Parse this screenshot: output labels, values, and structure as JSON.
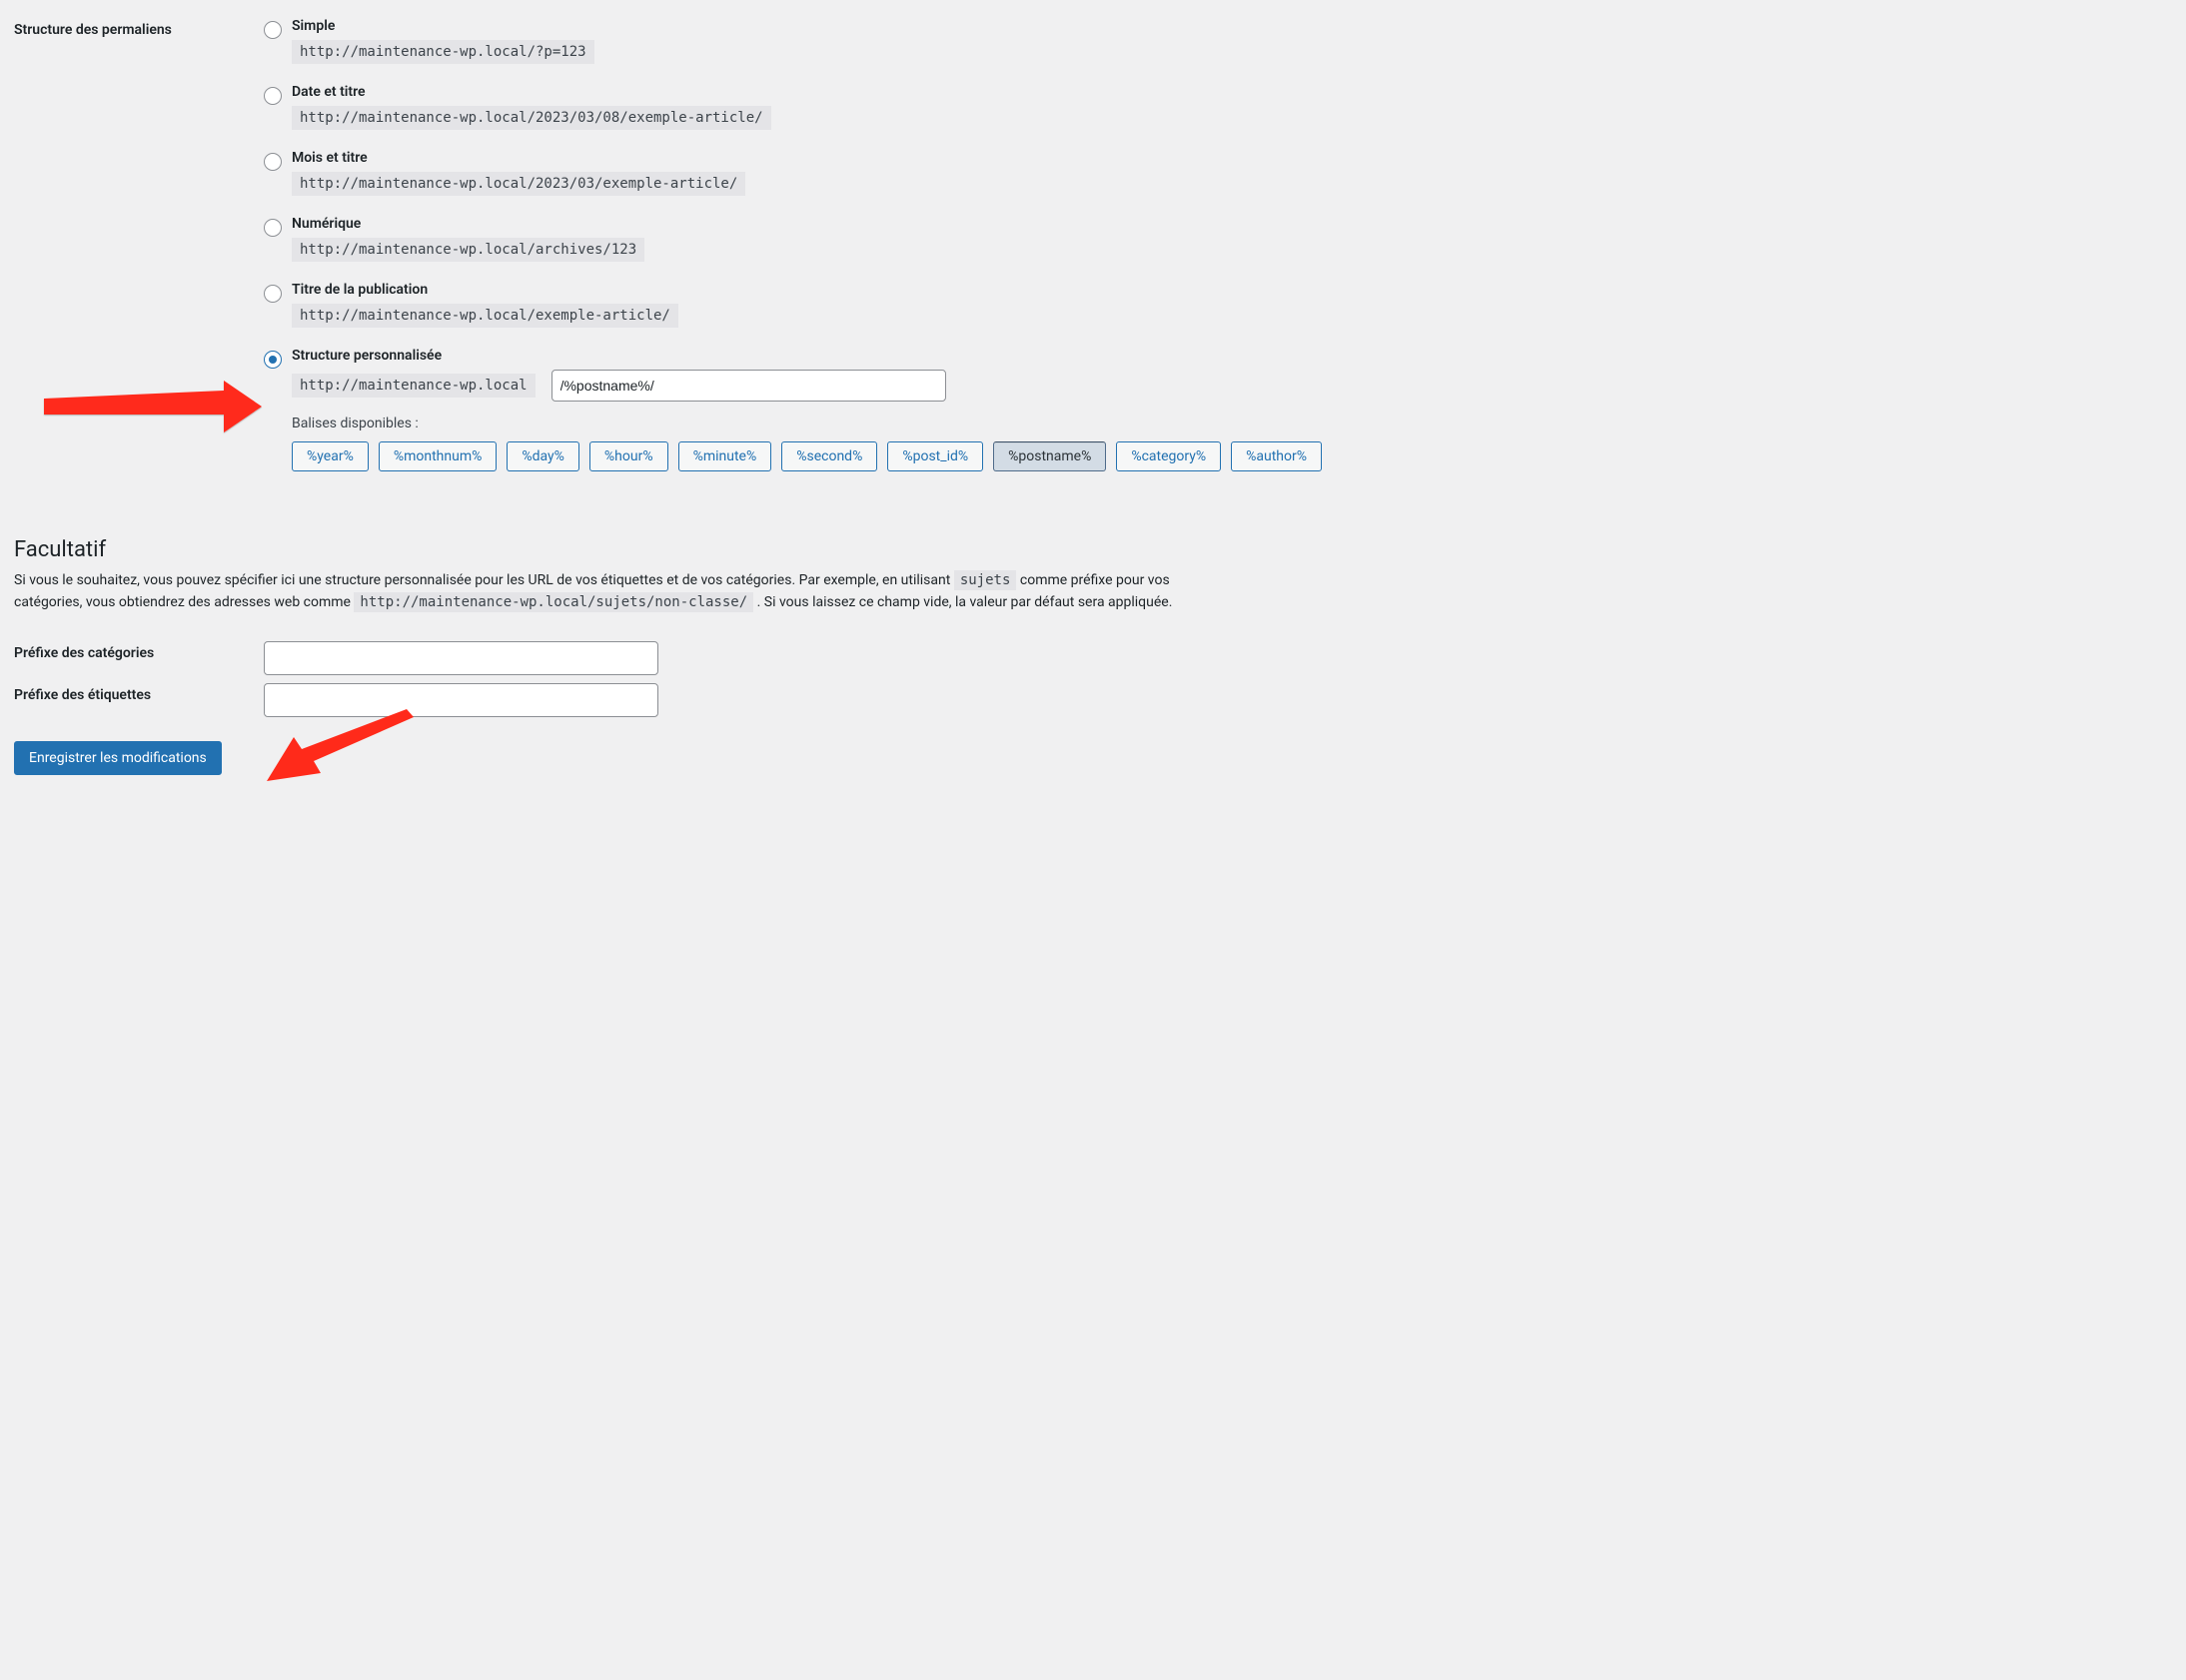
{
  "section_label": "Structure des permaliens",
  "options": {
    "simple": {
      "label": "Simple",
      "example": "http://maintenance-wp.local/?p=123"
    },
    "date_title": {
      "label": "Date et titre",
      "example": "http://maintenance-wp.local/2023/03/08/exemple-article/"
    },
    "month_title": {
      "label": "Mois et titre",
      "example": "http://maintenance-wp.local/2023/03/exemple-article/"
    },
    "numeric": {
      "label": "Numérique",
      "example": "http://maintenance-wp.local/archives/123"
    },
    "post_title": {
      "label": "Titre de la publication",
      "example": "http://maintenance-wp.local/exemple-article/"
    },
    "custom": {
      "label": "Structure personnalisée",
      "base": "http://maintenance-wp.local",
      "value": "/%postname%/"
    }
  },
  "tags_label": "Balises disponibles :",
  "tags": {
    "year": "%year%",
    "monthnum": "%monthnum%",
    "day": "%day%",
    "hour": "%hour%",
    "minute": "%minute%",
    "second": "%second%",
    "post_id": "%post_id%",
    "postname": "%postname%",
    "category": "%category%",
    "author": "%author%"
  },
  "optional": {
    "heading": "Facultatif",
    "desc_part1": "Si vous le souhaitez, vous pouvez spécifier ici une structure personnalisée pour les URL de vos étiquettes et de vos catégories. Par exemple, en utilisant ",
    "sample_prefix": "sujets",
    "desc_part2": " comme préfixe pour vos catégories, vous obtiendrez des adresses web comme ",
    "sample_url": "http://maintenance-wp.local/sujets/non-classe/",
    "desc_part3": " . Si vous laissez ce champ vide, la valeur par défaut sera appliquée.",
    "category_prefix_label": "Préfixe des catégories",
    "category_prefix_value": "",
    "tag_prefix_label": "Préfixe des étiquettes",
    "tag_prefix_value": ""
  },
  "submit_label": "Enregistrer les modifications"
}
